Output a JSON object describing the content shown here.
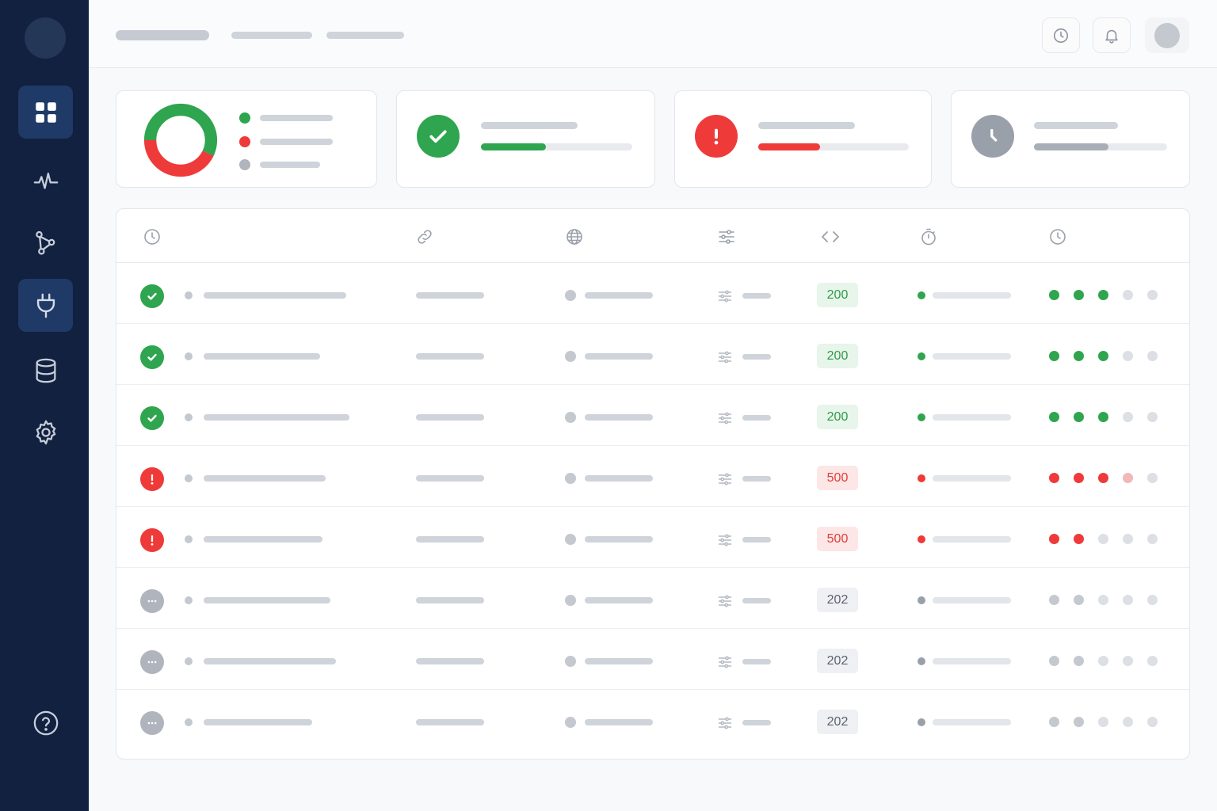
{
  "colors": {
    "sidebar_bg": "#12213f",
    "sidebar_active": "#1f3a66",
    "success": "#2ea54e",
    "error": "#ef3a3a",
    "pending": "#b0b5bd",
    "success_bg": "#e7f5ea",
    "error_bg": "#fde6e6",
    "pending_bg": "#eef0f3"
  },
  "sidebar": {
    "items": [
      {
        "icon": "grid-icon",
        "active": true
      },
      {
        "icon": "activity-icon",
        "active": false
      },
      {
        "icon": "branch-icon",
        "active": false
      },
      {
        "icon": "plug-icon",
        "active": true
      },
      {
        "icon": "database-icon",
        "active": false
      },
      {
        "icon": "gear-icon",
        "active": false
      },
      {
        "icon": "help-icon",
        "active": false
      }
    ]
  },
  "topbar": {
    "buttons": [
      {
        "icon": "clock-icon"
      },
      {
        "icon": "bell-icon"
      }
    ]
  },
  "summary": {
    "donut": {
      "success": 0.57,
      "error": 0.43
    },
    "cards": [
      {
        "status": "success",
        "progress": 0.43
      },
      {
        "status": "error",
        "progress": 0.41
      },
      {
        "status": "pending",
        "progress": 0.56
      }
    ]
  },
  "table": {
    "columns": [
      {
        "icon": "clock-icon"
      },
      {
        "icon": "link-icon"
      },
      {
        "icon": "globe-icon"
      },
      {
        "icon": "sliders-icon"
      },
      {
        "icon": "code-icon"
      },
      {
        "icon": "stopwatch-icon"
      },
      {
        "icon": "clock-icon"
      }
    ],
    "rows": [
      {
        "status": "success",
        "code": "200",
        "history": [
          "success",
          "success",
          "success",
          "muted",
          "muted"
        ]
      },
      {
        "status": "success",
        "code": "200",
        "history": [
          "success",
          "success",
          "success",
          "muted",
          "muted"
        ]
      },
      {
        "status": "success",
        "code": "200",
        "history": [
          "success",
          "success",
          "success",
          "muted",
          "muted"
        ]
      },
      {
        "status": "error",
        "code": "500",
        "history": [
          "error",
          "error",
          "error",
          "error-light",
          "muted"
        ]
      },
      {
        "status": "error",
        "code": "500",
        "history": [
          "error",
          "error",
          "muted",
          "muted",
          "muted"
        ]
      },
      {
        "status": "pending",
        "code": "202",
        "history": [
          "pending",
          "pending",
          "muted",
          "muted",
          "muted"
        ]
      },
      {
        "status": "pending",
        "code": "202",
        "history": [
          "pending",
          "pending",
          "muted",
          "muted",
          "muted"
        ]
      },
      {
        "status": "pending",
        "code": "202",
        "history": [
          "pending",
          "pending",
          "muted",
          "muted",
          "muted"
        ]
      }
    ]
  }
}
